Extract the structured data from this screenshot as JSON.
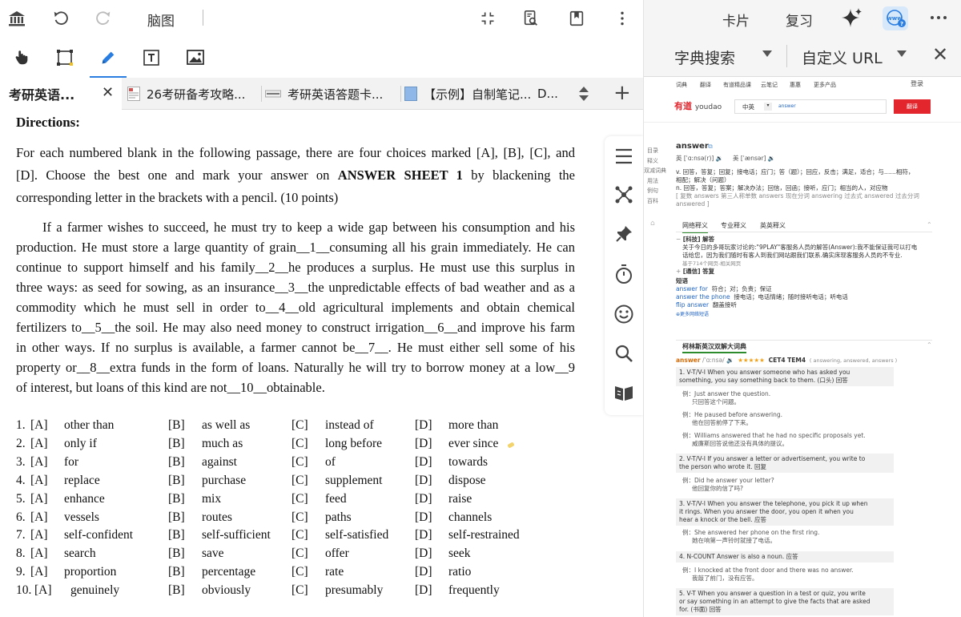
{
  "toolbar": {
    "mindmap_label": "脑图"
  },
  "tabs": [
    {
      "label": "考研英语..."
    },
    {
      "label": "26考研备考攻略..."
    },
    {
      "label": "考研英语答题卡..."
    },
    {
      "label": "【示例】自制笔记..."
    },
    {
      "label": "D..."
    }
  ],
  "doc": {
    "directions_title": "Directions:",
    "directions_l1a": "For each numbered blank in the following passage, there are four choices marked [A], [B], [C], and",
    "directions_l2a": "[D]. Choose the best one and mark your answer on ",
    "directions_bold": "ANSWER SHEET 1",
    "directions_l2b": " by blackening the",
    "directions_l3": "corresponding letter in the brackets with a pencil. (10 points)",
    "passage": [
      "If a farmer wishes to succeed, he must try to keep a wide gap between his consumption and his",
      "production. He must store a large quantity of grain__1__consuming all his grain immediately. He can",
      "continue to support himself and his family__2__he produces a surplus. He must use this surplus in",
      "three ways: as seed for sowing, as an insurance__3__the unpredictable effects of bad weather and as a",
      "commodity which he must sell in order to__4__old agricultural implements and obtain chemical",
      "fertilizers to__5__the soil. He may also need money to construct irrigation__6__and improve his farm",
      "in other ways. If no surplus is available, a farmer cannot be__7__. He must either sell some of his",
      "property or__8__extra funds in the form of loans. Naturally he will try to borrow money at a low__9",
      "of interest, but loans of this kind are not__10__obtainable."
    ],
    "options": [
      {
        "num": "1.",
        "a": "other than",
        "b": "as well as",
        "c": "instead of",
        "d": "more than"
      },
      {
        "num": "2.",
        "a": "only if",
        "b": "much as",
        "c": "long before",
        "d": "ever since"
      },
      {
        "num": "3.",
        "a": "for",
        "b": "against",
        "c": "of",
        "d": "towards"
      },
      {
        "num": "4.",
        "a": "replace",
        "b": "purchase",
        "c": "supplement",
        "d": "dispose"
      },
      {
        "num": "5.",
        "a": "enhance",
        "b": "mix",
        "c": "feed",
        "d": "raise"
      },
      {
        "num": "6.",
        "a": "vessels",
        "b": "routes",
        "c": "paths",
        "d": "channels"
      },
      {
        "num": "7.",
        "a": "self-confident",
        "b": "self-sufficient",
        "c": "self-satisfied",
        "d": "self-restrained"
      },
      {
        "num": "8.",
        "a": "search",
        "b": "save",
        "c": "offer",
        "d": "seek"
      },
      {
        "num": "9.",
        "a": "proportion",
        "b": "percentage",
        "c": "rate",
        "d": "ratio"
      },
      {
        "num": "10.",
        "a": "genuinely",
        "b": "obviously",
        "c": "presumably",
        "d": "frequently"
      }
    ],
    "letters": {
      "a": "[A]",
      "b": "[B]",
      "c": "[C]",
      "d": "[D]"
    }
  },
  "right": {
    "card_label": "卡片",
    "review_label": "复习",
    "dict_search_label": "字典搜索",
    "custom_url_label": "自定义 URL"
  },
  "youdao": {
    "nav": [
      "词典",
      "翻译",
      "有道精品课",
      "云笔记",
      "惠惠",
      "更多产品"
    ],
    "login": "登录",
    "brand_cn": "有道",
    "brand_en": "youdao",
    "lang": "中英",
    "query": "answer",
    "translate_btn": "翻译",
    "side_nav": [
      "目录",
      "释义",
      "双减词典",
      "用法",
      "例句",
      "百科"
    ],
    "word": "answer",
    "phon_uk": "英 [ˈɑːnsə(r)]",
    "phon_us": "美 [ˈænsər]",
    "def_v": "v. 回答，答复；回复；接电话；应门；答（题）；回应，反击；满足，适合；与……相符，",
    "def_v2": "相配；解决（问题）",
    "def_n": "n. 回答，答复；答案；解决办法；回信，回函；接听，应门；相当的人，对应物",
    "forms": "[ 复数 answers 第三人称单数 answers 现在分词 answering 过去式 answered 过去分词",
    "forms2": "answered ]",
    "tabs": [
      "网络释义",
      "专业释义",
      "英英释义"
    ],
    "web_tag": "[科技] 解答",
    "web_text1": "关于今日的多哥玩家讨论的:\"9PLAY\"客服务人员的解答(Answer):我不能保证我可以打电",
    "web_text2": "话给您，因为我们随时有客人到我们网站跟我们联系.确实床现客服务人员的不专业.",
    "web_src": "基于714个网页-相关网页",
    "comm_tag": "[通信] 答复",
    "phrases_title": "短语",
    "phrases": [
      {
        "en": "answer for",
        "cn": "符合；对；负责；保证"
      },
      {
        "en": "answer the phone",
        "cn": "接电话；电话情绪；随时接听电话；听电话"
      },
      {
        "en": "flip answer",
        "cn": "翻盖接听"
      }
    ],
    "more_phrases": "更多网络短语",
    "collins_title": "柯林斯英汉双解大词典",
    "collins_word": "answer",
    "collins_phon": "/ˈɑːnsə/",
    "collins_stars": "★★★★★",
    "collins_tags": "CET4 TEM4",
    "collins_forms": "( answering, answered, answers )",
    "c1": "1. V-T/V-I When you answer someone who has asked you",
    "c1b": "something, you say something back to them. (口头) 回答",
    "c1ex1": "例：Just answer the question.",
    "c1ex1cn": "只回答这个问题。",
    "c1ex2": "例：He paused before answering.",
    "c1ex2cn": "他在回答前停了下来。",
    "c1ex3": "例：Williams answered that he had no specific proposals yet.",
    "c1ex3cn": "威廉斯回答说他还没有具体的提议。",
    "c2": "2. V-T/V-I If you answer a letter or advertisement, you write to",
    "c2b": "the person who wrote it. 回复",
    "c2ex1": "例：Did he answer your letter?",
    "c2ex1cn": "他回复你的信了吗?",
    "c3": "3. V-T/V-I When you answer the telephone, you pick it up when",
    "c3b": "it rings. When you answer the door, you open it when you",
    "c3c": "hear a knock or the bell. 应答",
    "c3ex1": "例：She answered her phone on the first ring.",
    "c3ex1cn": "她在响第一声铃时就接了电话。",
    "c4": "4. N-COUNT Answer is also a noun. 应答",
    "c4ex1": "例：I knocked at the front door and there was no answer.",
    "c4ex1cn": "我敲了前门，没有应答。",
    "c5": "5. V-T When you answer a question in a test or quiz, you write",
    "c5b": "or say something in an attempt to give the facts that are asked",
    "c5c": "for. (书面) 回答"
  }
}
